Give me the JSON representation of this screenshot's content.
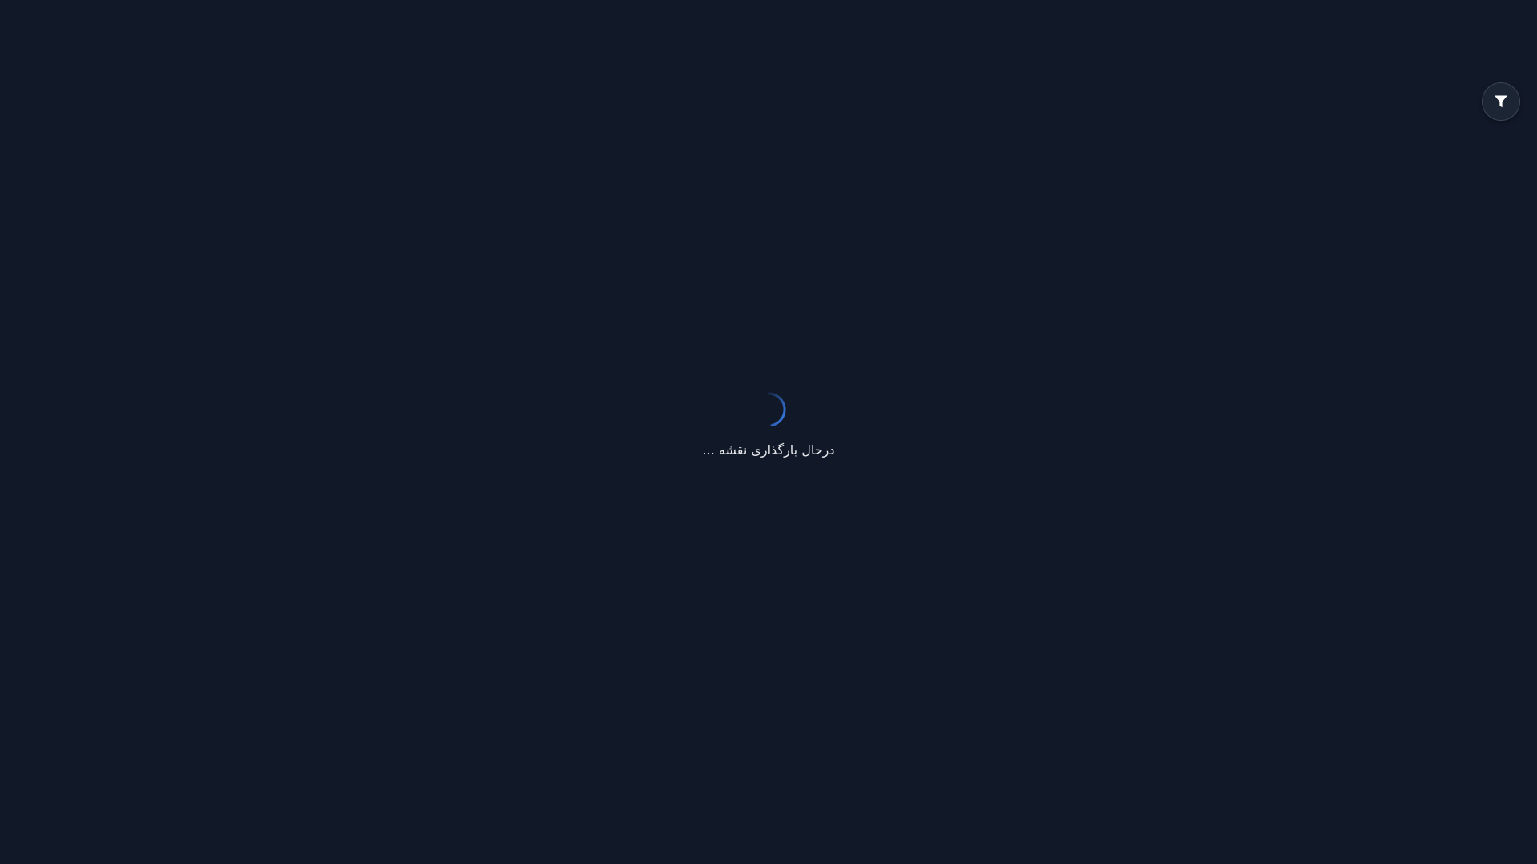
{
  "loader": {
    "text": "درحال بارگذاری نقشه ...",
    "spinner_icon": "loading-spinner-icon",
    "accent_color": "#3b82f6"
  },
  "filter_button": {
    "icon": "filter-icon"
  },
  "theme": {
    "background": "#111827",
    "button_background": "#1c2533",
    "button_border": "#3a4556",
    "text_color": "#e5e7eb"
  }
}
